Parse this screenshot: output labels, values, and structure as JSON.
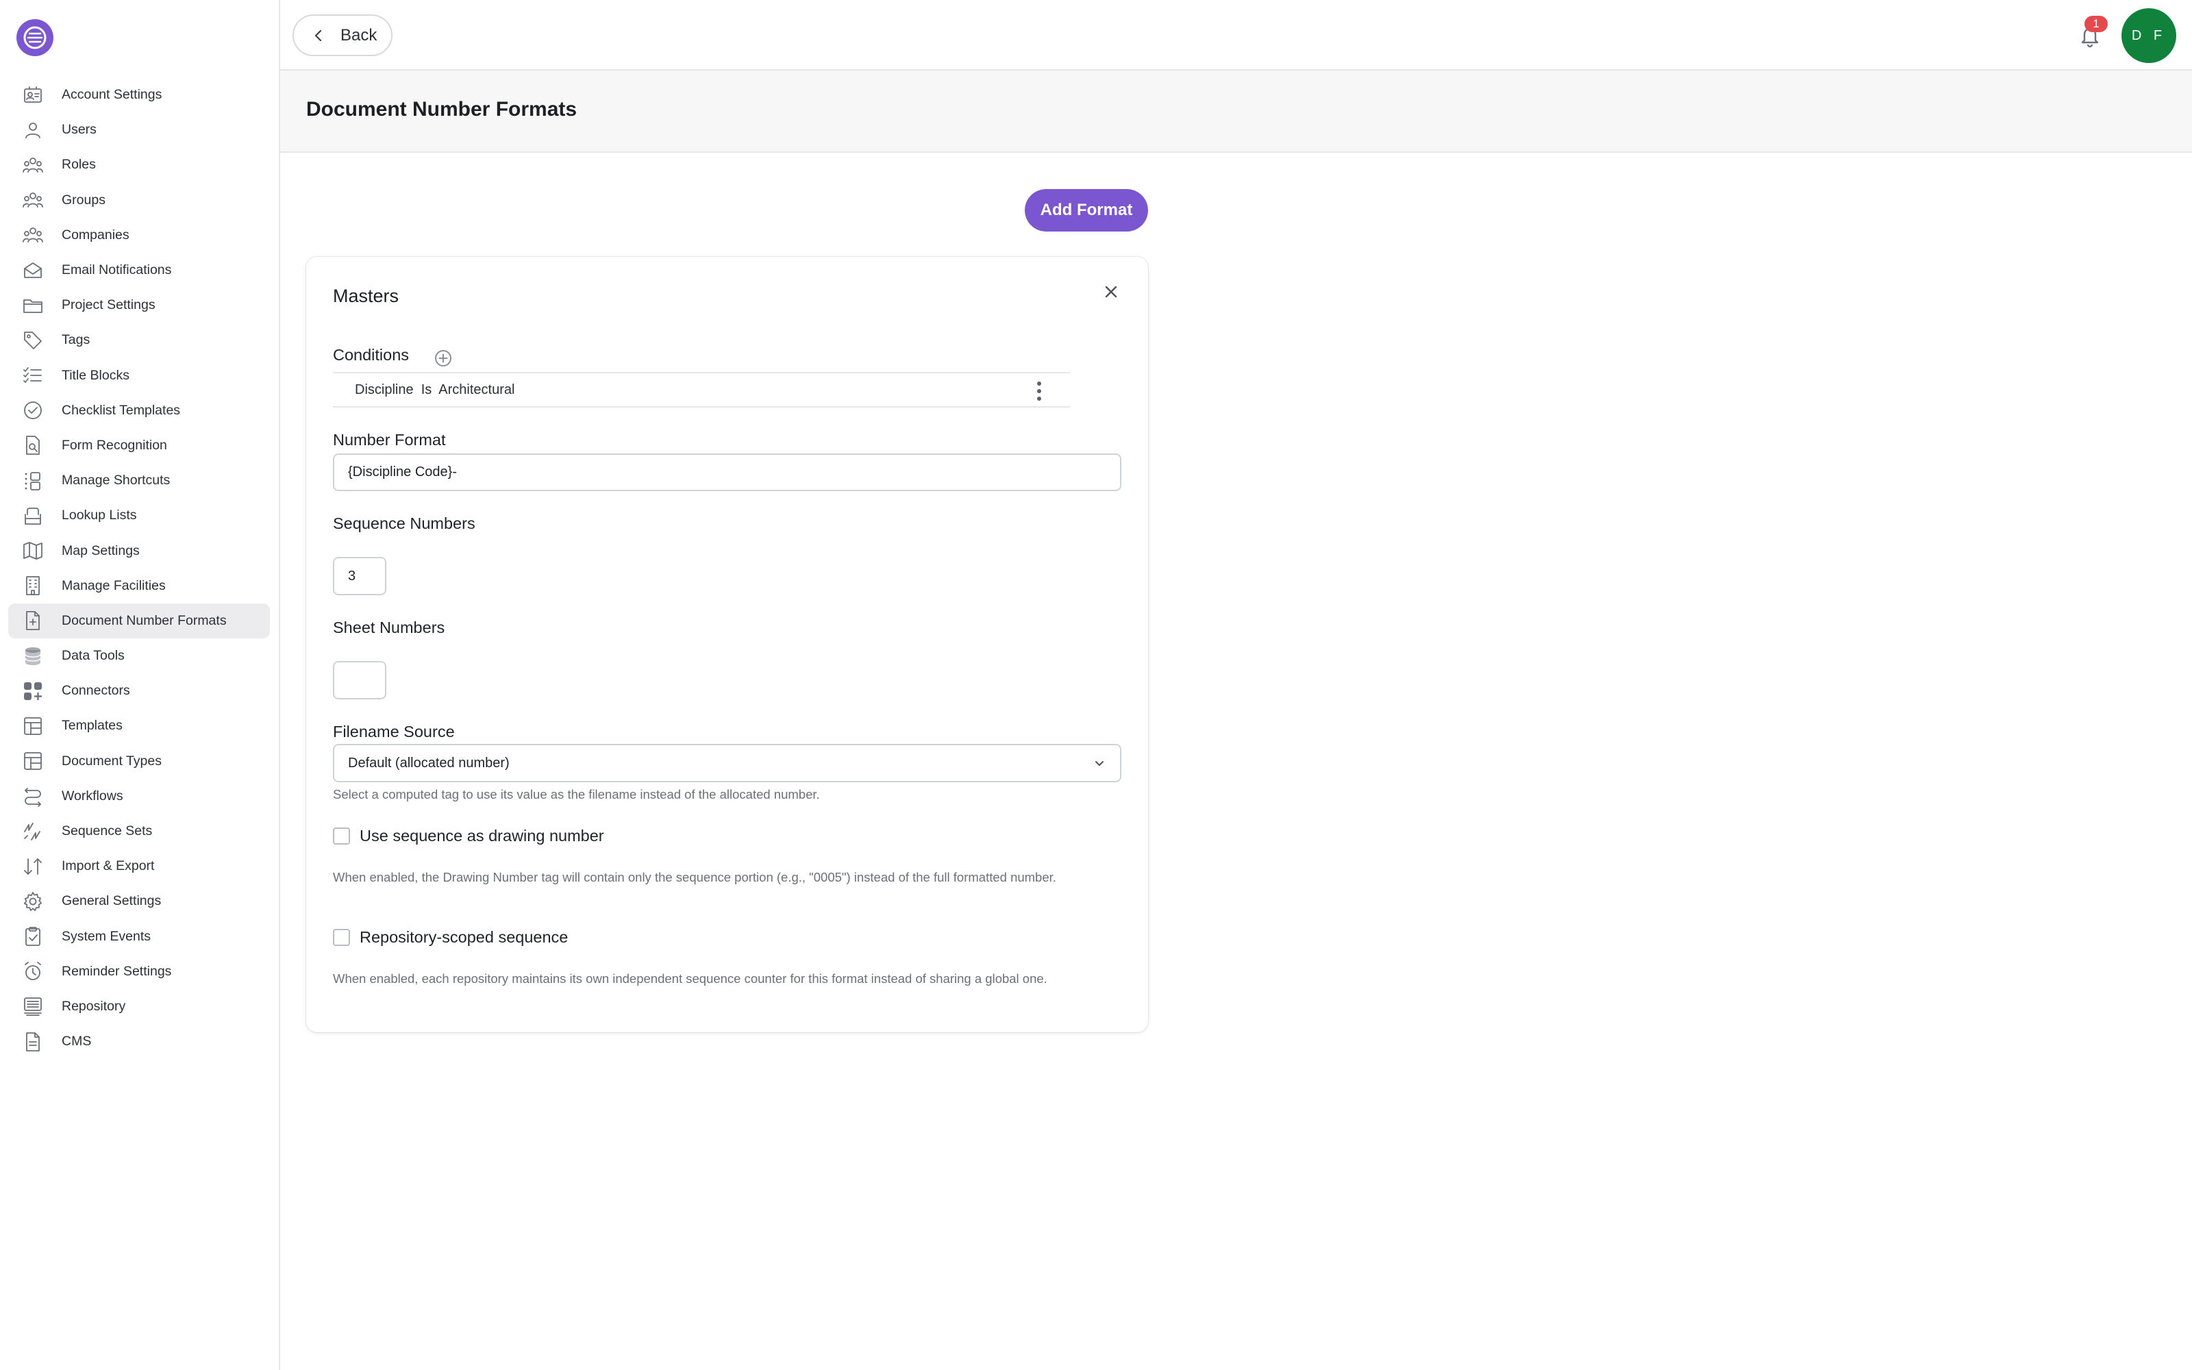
{
  "app": {
    "sidebar": {
      "items": [
        {
          "label": "Account Settings",
          "icon": "account-settings-icon",
          "active": false
        },
        {
          "label": "Users",
          "icon": "user-icon",
          "active": false
        },
        {
          "label": "Roles",
          "icon": "roles-icon",
          "active": false
        },
        {
          "label": "Groups",
          "icon": "groups-icon",
          "active": false
        },
        {
          "label": "Companies",
          "icon": "companies-icon",
          "active": false
        },
        {
          "label": "Email Notifications",
          "icon": "envelope-icon",
          "active": false
        },
        {
          "label": "Project Settings",
          "icon": "folder-icon",
          "active": false
        },
        {
          "label": "Tags",
          "icon": "tag-icon",
          "active": false
        },
        {
          "label": "Title Blocks",
          "icon": "checklist-icon",
          "active": false
        },
        {
          "label": "Checklist Templates",
          "icon": "check-circle-icon",
          "active": false
        },
        {
          "label": "Form Recognition",
          "icon": "document-search-icon",
          "active": false
        },
        {
          "label": "Manage Shortcuts",
          "icon": "shortcuts-icon",
          "active": false
        },
        {
          "label": "Lookup Lists",
          "icon": "stack-icon",
          "active": false
        },
        {
          "label": "Map Settings",
          "icon": "map-icon",
          "active": false
        },
        {
          "label": "Manage Facilities",
          "icon": "building-icon",
          "active": false
        },
        {
          "label": "Document Number Formats",
          "icon": "document-plus-icon",
          "active": true
        },
        {
          "label": "Data Tools",
          "icon": "database-icon",
          "active": false
        },
        {
          "label": "Connectors",
          "icon": "connectors-icon",
          "active": false
        },
        {
          "label": "Templates",
          "icon": "template-icon",
          "active": false
        },
        {
          "label": "Document Types",
          "icon": "template-icon",
          "active": false
        },
        {
          "label": "Workflows",
          "icon": "workflow-icon",
          "active": false
        },
        {
          "label": "Sequence Sets",
          "icon": "sequence-icon",
          "active": false
        },
        {
          "label": "Import & Export",
          "icon": "import-export-icon",
          "active": false
        },
        {
          "label": "General Settings",
          "icon": "gear-icon",
          "active": false
        },
        {
          "label": "System Events",
          "icon": "clipboard-check-icon",
          "active": false
        },
        {
          "label": "Reminder Settings",
          "icon": "alarm-clock-icon",
          "active": false
        },
        {
          "label": "Repository",
          "icon": "repository-icon",
          "active": false
        },
        {
          "label": "CMS",
          "icon": "file-icon",
          "active": false
        }
      ]
    },
    "topbar": {
      "back_label": "Back",
      "notification_count": "1",
      "avatar_initials": "D F"
    },
    "page": {
      "title": "Document Number Formats",
      "add_button": "Add Format"
    },
    "card": {
      "title": "Masters",
      "conditions_label": "Conditions",
      "condition_text": "Discipline  Is  Architectural",
      "number_format_label": "Number Format",
      "number_format_value": "{Discipline Code}-",
      "sequence_numbers_label": "Sequence Numbers",
      "sequence_numbers_value": "3",
      "sheet_numbers_label": "Sheet Numbers",
      "sheet_numbers_value": "",
      "filename_source_label": "Filename Source",
      "filename_source_value": "Default (allocated number)",
      "filename_source_help": "Select a computed tag to use its value as the filename instead of the allocated number.",
      "use_sequence_label": "Use sequence as drawing number",
      "use_sequence_checked": false,
      "use_sequence_help": "When enabled, the Drawing Number tag will contain only the sequence portion (e.g., \"0005\") instead of the full formatted number.",
      "repo_scoped_label": "Repository-scoped sequence",
      "repo_scoped_checked": false,
      "repo_scoped_help": "When enabled, each repository maintains its own independent sequence counter for this format instead of sharing a global one."
    },
    "colors": {
      "accent": "#7a57d1",
      "avatar": "#11823b",
      "badge": "#e5484d",
      "active_nav": "#ececef"
    }
  }
}
